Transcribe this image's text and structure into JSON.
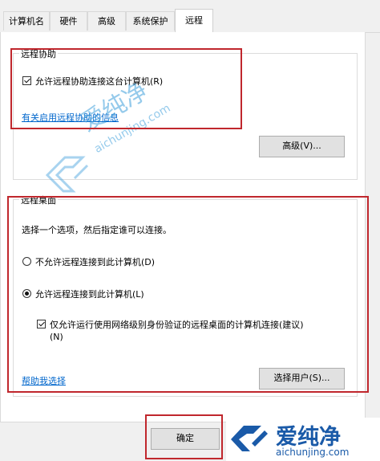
{
  "tabs": [
    {
      "label": "计算机名"
    },
    {
      "label": "硬件"
    },
    {
      "label": "高级"
    },
    {
      "label": "系统保护"
    },
    {
      "label": "远程"
    }
  ],
  "remote_assistance": {
    "group_title": "远程协助",
    "allow_checkbox_label": "允许远程协助连接这台计算机(R)",
    "allow_checked": true,
    "info_link": "有关启用远程协助的信息",
    "advanced_button": "高级(V)..."
  },
  "remote_desktop": {
    "group_title": "远程桌面",
    "instruction": "选择一个选项，然后指定谁可以连接。",
    "option_disallow": "不允许远程连接到此计算机(D)",
    "option_allow": "允许远程连接到此计算机(L)",
    "selected_option": "allow",
    "nla_checkbox_label_line1": "仅允许运行使用网络级别身份验证的远程桌面的计算机连接(建议)",
    "nla_checkbox_label_line2": "(N)",
    "nla_checked": true,
    "help_link": "帮助我选择",
    "select_users_button": "选择用户(S)..."
  },
  "footer": {
    "ok_button": "确定"
  },
  "watermark": {
    "cn": "爱纯净",
    "url": "aichunjing.com"
  },
  "logo": {
    "cn": "爱纯净",
    "url": "aichunjing.com"
  },
  "colors": {
    "highlight": "#c0272d",
    "link": "#0066cc",
    "logo_blue": "#1a5aa8"
  }
}
